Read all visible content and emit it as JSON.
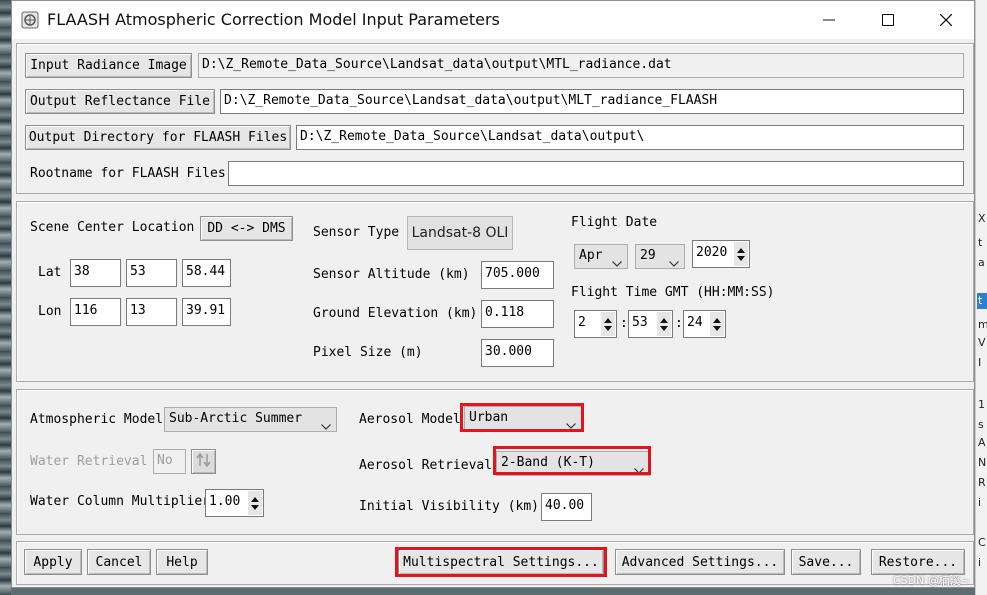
{
  "window": {
    "title": "FLAASH Atmospheric Correction Model Input Parameters",
    "minimize_icon": "minimize-icon",
    "maximize_icon": "maximize-icon",
    "close_icon": "close-icon"
  },
  "files": {
    "input_radiance_label": "Input Radiance Image",
    "input_radiance_value": "D:\\Z_Remote_Data_Source\\Landsat_data\\output\\MTL_radiance.dat",
    "output_reflectance_label": "Output Reflectance File",
    "output_reflectance_value": "D:\\Z_Remote_Data_Source\\Landsat_data\\output\\MLT_radiance_FLAASH",
    "output_directory_label": "Output Directory for FLAASH Files",
    "output_directory_value": "D:\\Z_Remote_Data_Source\\Landsat_data\\output\\",
    "rootname_label": "Rootname for FLAASH Files",
    "rootname_value": ""
  },
  "scene": {
    "location_label": "Scene Center Location",
    "dd_dms_button": "DD <-> DMS",
    "lat_label": "Lat",
    "lat_deg": "38",
    "lat_min": "53",
    "lat_sec": "58.44",
    "lon_label": "Lon",
    "lon_deg": "116",
    "lon_min": "13",
    "lon_sec": "39.91"
  },
  "sensor": {
    "type_label": "Sensor Type",
    "type_value": "Landsat-8 OLI",
    "altitude_label": "Sensor Altitude (km)",
    "altitude_value": "705.000",
    "elevation_label": "Ground Elevation (km)",
    "elevation_value": "0.118",
    "pixel_label": "Pixel Size (m)",
    "pixel_value": "30.000"
  },
  "flight": {
    "date_label": "Flight Date",
    "month": "Apr",
    "day": "29",
    "year": "2020",
    "time_label": "Flight Time GMT (HH:MM:SS)",
    "hour": "2",
    "minute": "53",
    "second": "24",
    "separator": ":"
  },
  "atmosphere": {
    "model_label": "Atmospheric Model",
    "model_value": "Sub-Arctic Summer",
    "water_retrieval_label": "Water Retrieval",
    "water_retrieval_value": "No",
    "water_column_label": "Water Column Multiplier",
    "water_column_value": "1.00",
    "aerosol_model_label": "Aerosol Model",
    "aerosol_model_value": "Urban",
    "aerosol_retrieval_label": "Aerosol Retrieval",
    "aerosol_retrieval_value": "2-Band (K-T)",
    "visibility_label": "Initial Visibility (km)",
    "visibility_value": "40.00"
  },
  "actions": {
    "apply": "Apply",
    "cancel": "Cancel",
    "help": "Help",
    "multispectral": "Multispectral Settings...",
    "advanced": "Advanced Settings...",
    "save": "Save...",
    "restore": "Restore..."
  },
  "watermark": "CSDN @楠溪~",
  "background_chars": [
    "X",
    "t",
    "a",
    "t",
    "m",
    "V",
    "I",
    "1",
    "s",
    "A",
    "N",
    "R",
    "i",
    "C",
    "i"
  ],
  "colors": {
    "highlight": "#e0161c",
    "selection": "#2f7fd0"
  }
}
